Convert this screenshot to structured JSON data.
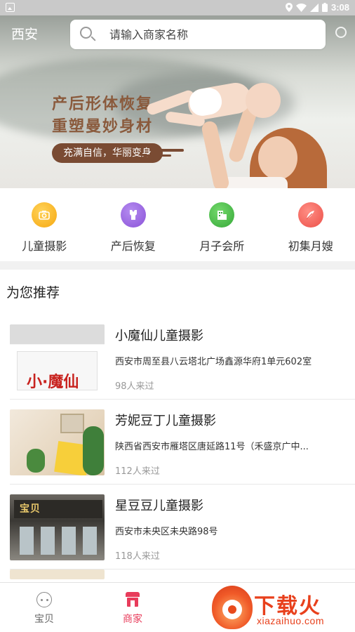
{
  "status_bar": {
    "time": "3:08"
  },
  "header": {
    "city": "西安",
    "search_placeholder": "请输入商家名称"
  },
  "banner": {
    "headline_1": "产后形体恢复",
    "headline_2": "重塑曼妙身材",
    "tagline": "充满自信，华丽变身",
    "active_dot": 0,
    "dot_count": 3
  },
  "categories": [
    {
      "label": "儿童摄影",
      "icon": "camera-icon",
      "color": "#f6b51a"
    },
    {
      "label": "产后恢复",
      "icon": "bodysuit-icon",
      "color": "#9b6ae0"
    },
    {
      "label": "月子会所",
      "icon": "building-icon",
      "color": "#4cbf4a"
    },
    {
      "label": "初集月嫂",
      "icon": "feather-icon",
      "color": "#f0675b"
    }
  ],
  "recommend": {
    "title": "为您推荐",
    "items": [
      {
        "name": "小魔仙儿童摄影",
        "address": "西安市周至县八云塔北广场鑫源华府1单元602室",
        "visits": "98人来过",
        "thumb_text": "小·魔仙"
      },
      {
        "name": "芳妮豆丁儿童摄影",
        "address": "陕西省西安市雁塔区唐延路11号（禾盛京广中...",
        "visits": "112人来过"
      },
      {
        "name": "星豆豆儿童摄影",
        "address": "西安市未央区未央路98号",
        "visits": "118人来过",
        "thumb_text": "宝贝"
      }
    ]
  },
  "bottom_nav": [
    {
      "label": "宝贝",
      "icon": "baby-face-icon",
      "active": false
    },
    {
      "label": "商家",
      "icon": "shop-icon",
      "active": true
    }
  ],
  "watermark": {
    "title": "下载火",
    "url": "xiazaihuo.com"
  },
  "colors": {
    "accent": "#e83c5b",
    "banner_text": "#8a5a3c",
    "pill": "#7a4b33"
  }
}
